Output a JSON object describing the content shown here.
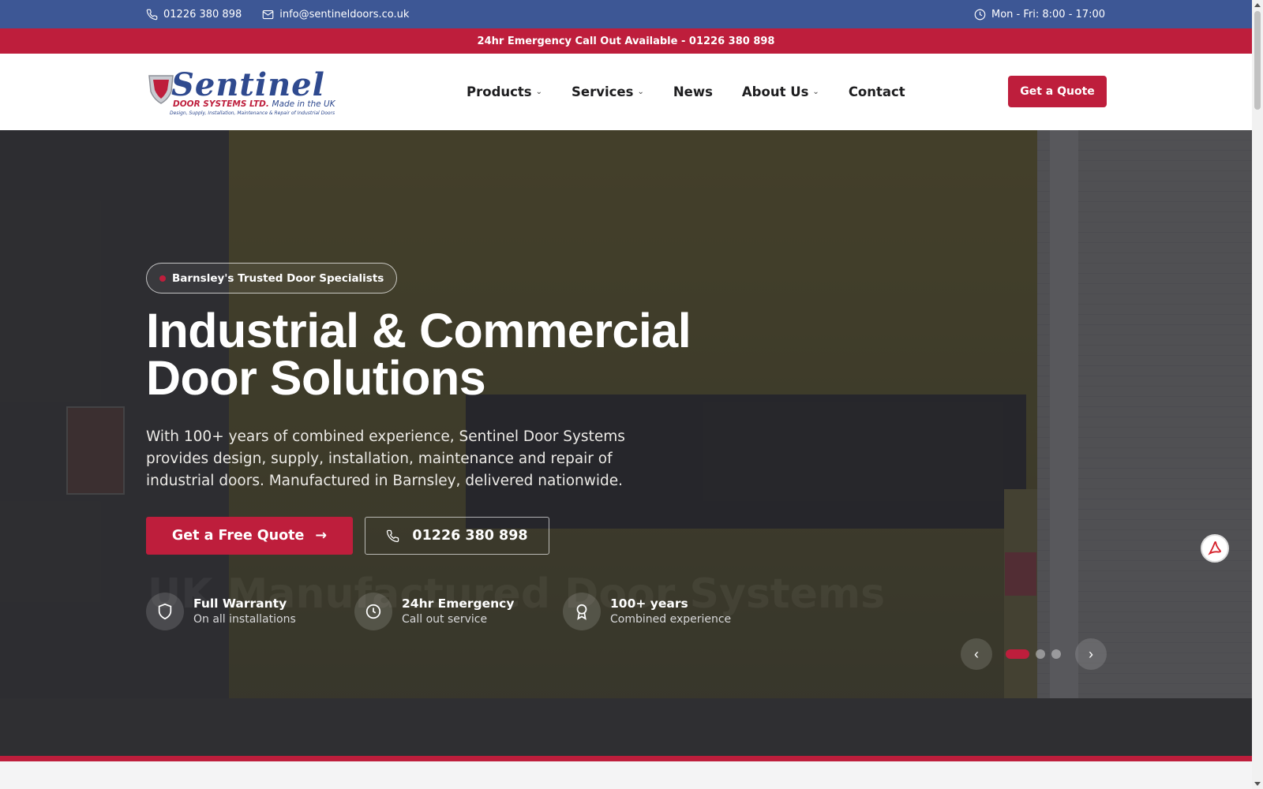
{
  "topbar": {
    "phone": "01226 380 898",
    "email": "info@sentineldoors.co.uk",
    "hours": "Mon - Fri: 8:00 - 17:00"
  },
  "emergency": {
    "text": "24hr Emergency Call Out Available - 01226 380 898"
  },
  "logo": {
    "word": "Sentinel",
    "sub": "DOOR SYSTEMS LTD.",
    "made": "Made in the UK",
    "tagline": "Design, Supply, Installation, Maintenance & Repair of Industrial Doors"
  },
  "nav": {
    "items": [
      {
        "label": "Products",
        "dropdown": true
      },
      {
        "label": "Services",
        "dropdown": true
      },
      {
        "label": "News",
        "dropdown": false
      },
      {
        "label": "About Us",
        "dropdown": true
      },
      {
        "label": "Contact",
        "dropdown": false
      }
    ],
    "quote_label": "Get a Quote"
  },
  "hero": {
    "badge": "Barnsley's Trusted Door Specialists",
    "headline_line1": "Industrial & Commercial",
    "headline_line2": "Door Solutions",
    "lede": "With 100+ years of combined experience, Sentinel Door Systems provides design, supply, installation, maintenance and repair of industrial doors. Manufactured in Barnsley, delivered nationwide.",
    "cta_primary": "Get a Free Quote",
    "cta_secondary": "01226 380 898",
    "ghost_headline": "UK Manufactured Door Systems",
    "features": [
      {
        "title": "Full Warranty",
        "subtitle": "On all installations",
        "icon": "shield-icon"
      },
      {
        "title": "24hr Emergency",
        "subtitle": "Call out service",
        "icon": "clock-icon"
      },
      {
        "title": "100+ years",
        "subtitle": "Combined experience",
        "icon": "award-icon"
      }
    ],
    "slider": {
      "total": 3,
      "active": 1
    }
  },
  "colors": {
    "brand_blue": "#3d5795",
    "brand_red": "#be1e3c"
  }
}
